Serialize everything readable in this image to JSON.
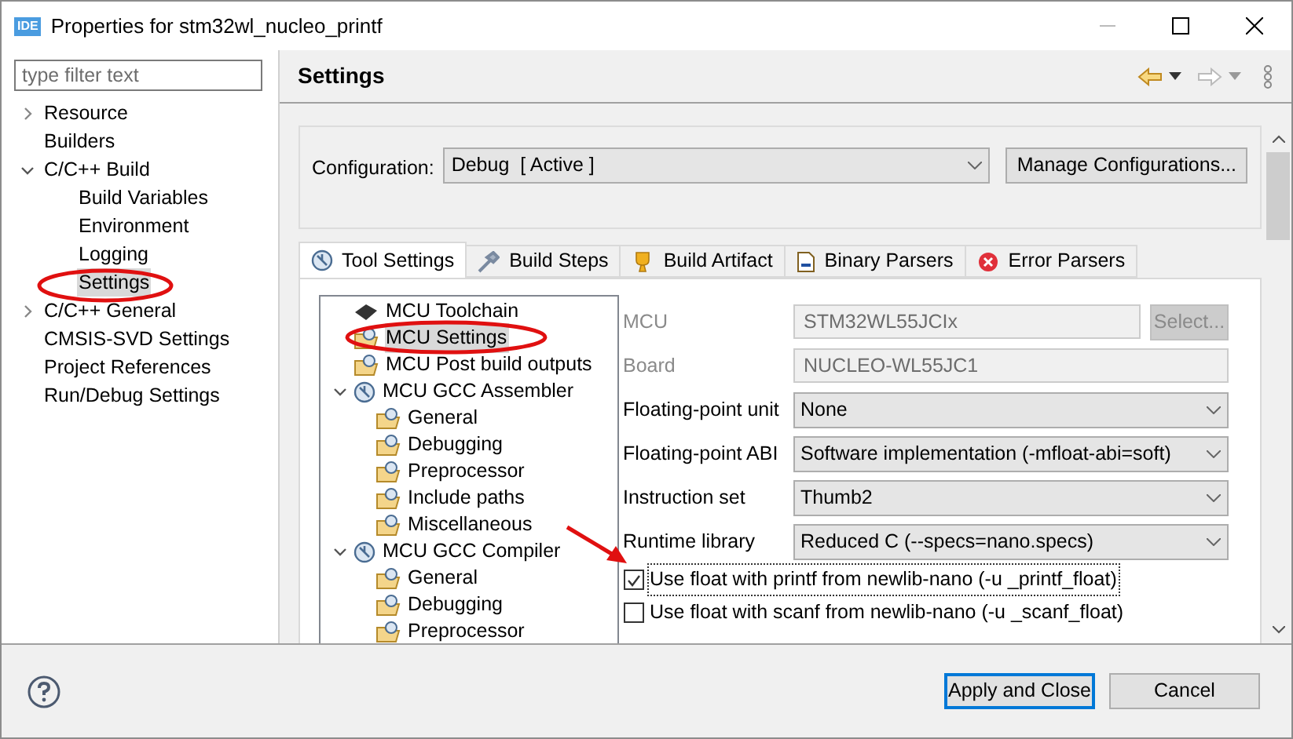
{
  "window": {
    "title": "Properties for stm32wl_nucleo_printf",
    "app_badge": "IDE"
  },
  "sidebar": {
    "filter": {
      "placeholder": "type filter text"
    },
    "items": [
      {
        "label": "Resource",
        "expanded": false,
        "selected": false
      },
      {
        "label": "Builders",
        "selected": false
      },
      {
        "label": "C/C++ Build",
        "expanded": true,
        "selected": false,
        "children": [
          {
            "label": "Build Variables",
            "selected": false
          },
          {
            "label": "Environment",
            "selected": false
          },
          {
            "label": "Logging",
            "selected": false
          },
          {
            "label": "Settings",
            "selected": true
          }
        ]
      },
      {
        "label": "C/C++ General",
        "expanded": false,
        "selected": false
      },
      {
        "label": "CMSIS-SVD Settings",
        "selected": false
      },
      {
        "label": "Project References",
        "selected": false
      },
      {
        "label": "Run/Debug Settings",
        "selected": false
      }
    ]
  },
  "page": {
    "title": "Settings",
    "configuration": {
      "label": "Configuration:",
      "value": "Debug  [ Active ]",
      "button": "Manage Configurations..."
    },
    "tabs": [
      {
        "label": "Tool Settings",
        "kind": "tool",
        "selected": true
      },
      {
        "label": "Build Steps",
        "kind": "steps",
        "selected": false
      },
      {
        "label": "Build Artifact",
        "kind": "trophy",
        "selected": false
      },
      {
        "label": "Binary Parsers",
        "kind": "binary",
        "selected": false
      },
      {
        "label": "Error Parsers",
        "kind": "error",
        "selected": false
      }
    ],
    "tool_tree": [
      {
        "label": "MCU Toolchain",
        "kind": "chip",
        "selected": false
      },
      {
        "label": "MCU Settings",
        "kind": "folder",
        "selected": true
      },
      {
        "label": "MCU Post build outputs",
        "kind": "folder",
        "selected": false
      },
      {
        "label": "MCU GCC Assembler",
        "kind": "tool",
        "expanded": true,
        "selected": false,
        "children": [
          {
            "label": "General",
            "kind": "folder",
            "selected": false
          },
          {
            "label": "Debugging",
            "kind": "folder",
            "selected": false
          },
          {
            "label": "Preprocessor",
            "kind": "folder",
            "selected": false
          },
          {
            "label": "Include paths",
            "kind": "folder",
            "selected": false
          },
          {
            "label": "Miscellaneous",
            "kind": "folder",
            "selected": false
          }
        ]
      },
      {
        "label": "MCU GCC Compiler",
        "kind": "tool",
        "expanded": true,
        "selected": false,
        "children": [
          {
            "label": "General",
            "kind": "folder",
            "selected": false
          },
          {
            "label": "Debugging",
            "kind": "folder",
            "selected": false
          },
          {
            "label": "Preprocessor",
            "kind": "folder",
            "selected": false
          }
        ]
      }
    ],
    "fields": [
      {
        "label": "MCU",
        "kind": "text",
        "value": "STM32WL55JCIx",
        "disabled": true,
        "button": "Select..."
      },
      {
        "label": "Board",
        "kind": "text",
        "value": "NUCLEO-WL55JC1",
        "disabled": true
      },
      {
        "label": "Floating-point unit",
        "kind": "select",
        "value": "None",
        "disabled": false
      },
      {
        "label": "Floating-point ABI",
        "kind": "select",
        "value": "Software implementation (-mfloat-abi=soft)",
        "disabled": false
      },
      {
        "label": "Instruction set",
        "kind": "select",
        "value": "Thumb2",
        "disabled": false
      },
      {
        "label": "Runtime library",
        "kind": "select",
        "value": "Reduced C (--specs=nano.specs)",
        "disabled": false
      }
    ],
    "checkboxes": [
      {
        "label": "Use float with printf from newlib-nano (-u _printf_float)",
        "checked": true,
        "focused": true
      },
      {
        "label": "Use float with scanf from newlib-nano (-u _scanf_float)",
        "checked": false,
        "focused": false
      }
    ]
  },
  "buttons": [
    {
      "label": "Apply and Close",
      "default": true
    },
    {
      "label": "Cancel",
      "default": false
    }
  ]
}
